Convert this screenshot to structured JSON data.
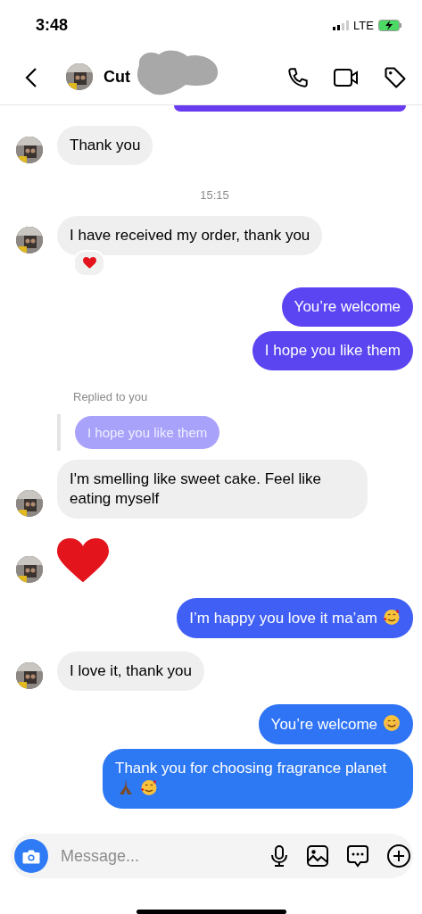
{
  "status_bar": {
    "time": "3:48",
    "network": "LTE"
  },
  "header": {
    "title": "Cut"
  },
  "messages": [
    {
      "kind": "cut-bubble",
      "color": "#6a3cf0"
    },
    {
      "kind": "incoming",
      "text": "Thank you"
    },
    {
      "kind": "timestamp",
      "text": "15:15"
    },
    {
      "kind": "incoming",
      "text": "I have received my order, thank you",
      "reaction": {
        "kind": "heart"
      }
    },
    {
      "kind": "outgoing",
      "text": "You’re welcome",
      "color": "#5b44f2"
    },
    {
      "kind": "outgoing",
      "text": "I hope you like them",
      "color": "#5a45f0"
    },
    {
      "kind": "reply-note",
      "text": "Replied to you"
    },
    {
      "kind": "quoted",
      "text": "I hope you like them"
    },
    {
      "kind": "incoming",
      "text": "I'm smelling like sweet cake. Feel like eating myself"
    },
    {
      "kind": "heart"
    },
    {
      "kind": "outgoing",
      "text": "I’m happy you love it ma’am",
      "color": "#3f5ff5",
      "emoji": [
        {
          "kind": "hearts-face"
        }
      ]
    },
    {
      "kind": "incoming",
      "text": "I love it, thank you"
    },
    {
      "kind": "outgoing",
      "text": "You’re welcome",
      "color": "#2f74f4",
      "emoji": [
        {
          "kind": "smile-face"
        }
      ]
    },
    {
      "kind": "outgoing",
      "text": "Thank you for choosing fragrance planet",
      "color": "#2d78f3",
      "emoji": [
        {
          "kind": "praying-hands"
        },
        {
          "kind": "hearts-face"
        }
      ]
    }
  ],
  "composer": {
    "placeholder": "Message..."
  }
}
